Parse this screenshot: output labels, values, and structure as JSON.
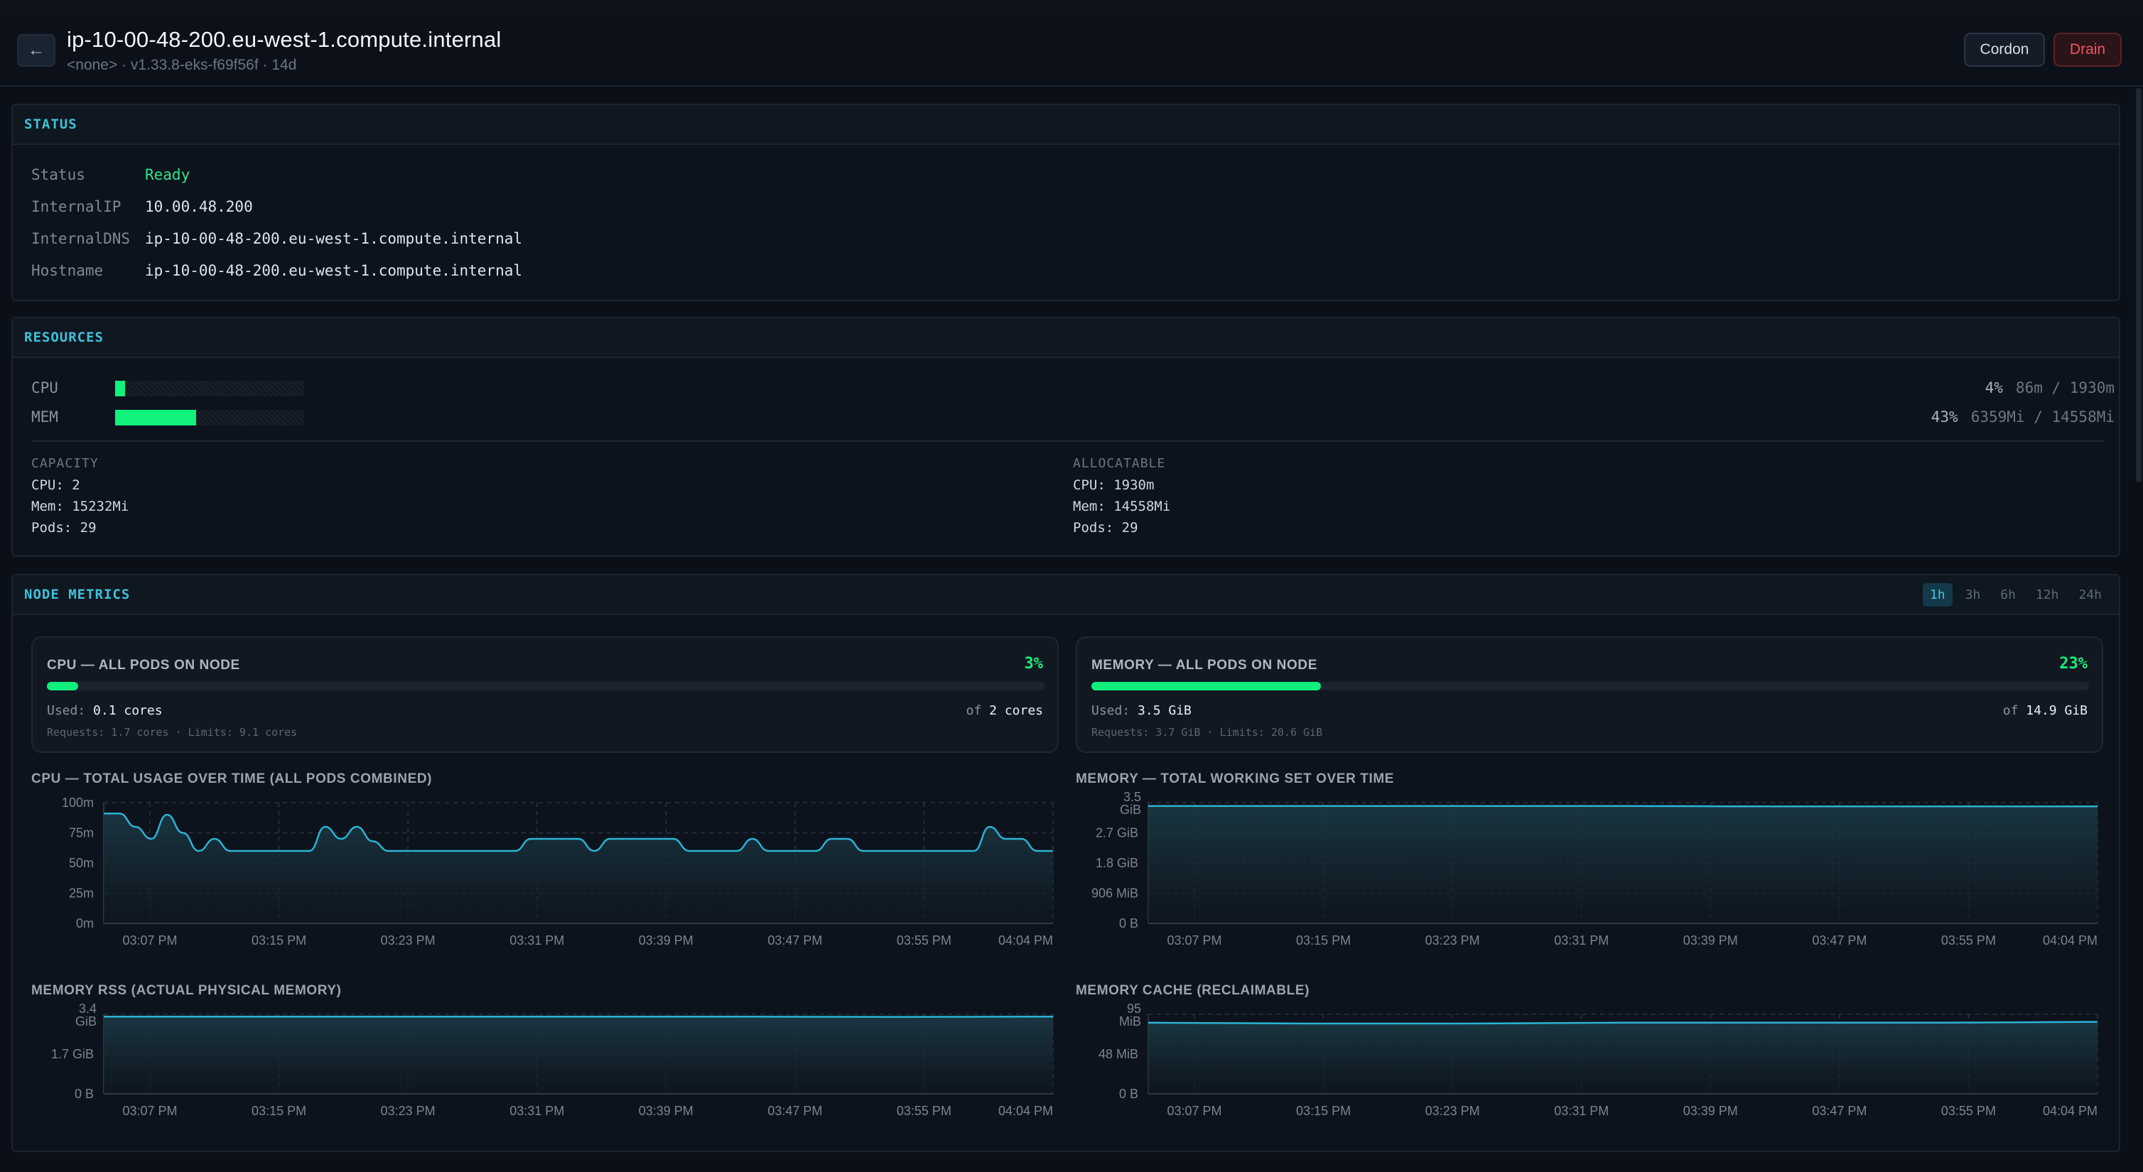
{
  "header": {
    "title": "ip-10-00-48-200.eu-west-1.compute.internal",
    "subtitle": "<none> · v1.33.8-eks-f69f56f · 14d",
    "back_icon": "←",
    "cordon_label": "Cordon",
    "drain_label": "Drain"
  },
  "status": {
    "title": "STATUS",
    "rows": [
      {
        "key": "Status",
        "value": "Ready"
      },
      {
        "key": "InternalIP",
        "value": "10.00.48.200"
      },
      {
        "key": "InternalDNS",
        "value": "ip-10-00-48-200.eu-west-1.compute.internal"
      },
      {
        "key": "Hostname",
        "value": "ip-10-00-48-200.eu-west-1.compute.internal"
      }
    ]
  },
  "resources": {
    "title": "RESOURCES",
    "cpu": {
      "label": "CPU",
      "percent_text": "4%",
      "fraction": 0.04,
      "detail": "86m / 1930m"
    },
    "mem": {
      "label": "MEM",
      "percent_text": "43%",
      "fraction": 0.43,
      "detail": "6359Mi / 14558Mi"
    },
    "capacity": {
      "heading": "CAPACITY",
      "cpu": "CPU: 2",
      "mem": "Mem: 15232Mi",
      "pods": "Pods: 29"
    },
    "allocatable": {
      "heading": "ALLOCATABLE",
      "cpu": "CPU: 1930m",
      "mem": "Mem: 14558Mi",
      "pods": "Pods: 29"
    }
  },
  "metrics": {
    "title": "NODE METRICS",
    "ranges": [
      "1h",
      "3h",
      "6h",
      "12h",
      "24h"
    ],
    "active_range": "1h",
    "cpu_card": {
      "title": "CPU — ALL PODS ON NODE",
      "percent_text": "3%",
      "fraction": 0.03,
      "used_label": "Used:",
      "used_value": "0.1 cores",
      "of_label": "of",
      "of_value": "2 cores",
      "requests": "Requests: 1.7 cores · Limits: 9.1 cores"
    },
    "mem_card": {
      "title": "MEMORY — ALL PODS ON NODE",
      "percent_text": "23%",
      "fraction": 0.23,
      "used_label": "Used:",
      "used_value": "3.5 GiB",
      "of_label": "of",
      "of_value": "14.9 GiB",
      "requests": "Requests: 3.7 GiB · Limits: 20.6 GiB"
    },
    "chart_titles": {
      "cpu": "CPU — TOTAL USAGE OVER TIME (ALL PODS COMBINED)",
      "mem": "MEMORY — TOTAL WORKING SET OVER TIME",
      "rss": "MEMORY RSS (ACTUAL PHYSICAL MEMORY)",
      "cache": "MEMORY CACHE (RECLAIMABLE)"
    },
    "colors": {
      "line": "#2bb3d4",
      "accent_green": "#10ef7c",
      "accent_cyan": "#3fc1d9"
    }
  },
  "chart_data": [
    {
      "type": "area",
      "title": "CPU — TOTAL USAGE OVER TIME (ALL PODS COMBINED)",
      "x_ticks": [
        "03:07 PM",
        "03:15 PM",
        "03:23 PM",
        "03:31 PM",
        "03:39 PM",
        "03:47 PM",
        "03:55 PM",
        "04:04 PM"
      ],
      "y_ticks": [
        "0m",
        "25m",
        "50m",
        "75m",
        "100m"
      ],
      "ylim": [
        0,
        100
      ],
      "x": [
        0,
        1,
        2,
        3,
        4,
        5,
        6,
        7,
        8,
        9,
        10,
        11,
        12,
        13,
        14,
        15,
        16,
        17,
        18,
        19,
        20,
        21,
        22,
        23,
        24,
        25,
        26,
        27,
        28,
        29,
        30,
        31,
        32,
        33,
        34,
        35,
        36,
        37,
        38,
        39,
        40,
        41,
        42,
        43,
        44,
        45,
        46,
        47,
        48,
        49,
        50,
        51,
        52,
        53,
        54,
        55,
        56,
        57,
        58,
        59,
        60
      ],
      "series": [
        {
          "values": [
            91,
            91,
            80,
            70,
            90,
            75,
            60,
            70,
            60,
            60,
            60,
            60,
            60,
            60,
            80,
            70,
            80,
            68,
            60,
            60,
            60,
            60,
            60,
            60,
            60,
            60,
            60,
            70,
            70,
            70,
            70,
            60,
            70,
            70,
            70,
            70,
            70,
            60,
            60,
            60,
            60,
            70,
            60,
            60,
            60,
            60,
            70,
            70,
            60,
            60,
            60,
            60,
            60,
            60,
            60,
            60,
            80,
            70,
            70,
            60,
            60
          ]
        }
      ]
    },
    {
      "type": "area",
      "title": "MEMORY — TOTAL WORKING SET OVER TIME",
      "x_ticks": [
        "03:07 PM",
        "03:15 PM",
        "03:23 PM",
        "03:31 PM",
        "03:39 PM",
        "03:47 PM",
        "03:55 PM",
        "04:04 PM"
      ],
      "y_ticks": [
        "0 B",
        "906 MiB",
        "1.8 GiB",
        "2.7 GiB",
        "3.5 GiB"
      ],
      "ylim": [
        0,
        3.55
      ],
      "x": [
        0,
        10,
        20,
        30,
        40,
        50,
        60
      ],
      "series": [
        {
          "values": [
            3.45,
            3.45,
            3.45,
            3.45,
            3.44,
            3.44,
            3.44
          ]
        }
      ]
    },
    {
      "type": "area",
      "title": "MEMORY RSS (ACTUAL PHYSICAL MEMORY)",
      "x_ticks": [
        "03:07 PM",
        "03:15 PM",
        "03:23 PM",
        "03:31 PM",
        "03:39 PM",
        "03:47 PM",
        "03:55 PM",
        "04:04 PM"
      ],
      "y_ticks": [
        "0 B",
        "1.7 GiB",
        "3.4 GiB"
      ],
      "ylim": [
        0,
        3.4
      ],
      "x": [
        0,
        10,
        20,
        30,
        40,
        50,
        60
      ],
      "series": [
        {
          "values": [
            3.3,
            3.3,
            3.3,
            3.3,
            3.3,
            3.29,
            3.3
          ]
        }
      ]
    },
    {
      "type": "area",
      "title": "MEMORY CACHE (RECLAIMABLE)",
      "x_ticks": [
        "03:07 PM",
        "03:15 PM",
        "03:23 PM",
        "03:31 PM",
        "03:39 PM",
        "03:47 PM",
        "03:55 PM",
        "04:04 PM"
      ],
      "y_ticks": [
        "0 B",
        "48 MiB",
        "95 MiB"
      ],
      "ylim": [
        0,
        95
      ],
      "x": [
        0,
        10,
        20,
        30,
        40,
        50,
        60
      ],
      "series": [
        {
          "values": [
            85,
            84,
            84,
            85,
            85,
            85,
            86
          ]
        }
      ]
    }
  ]
}
